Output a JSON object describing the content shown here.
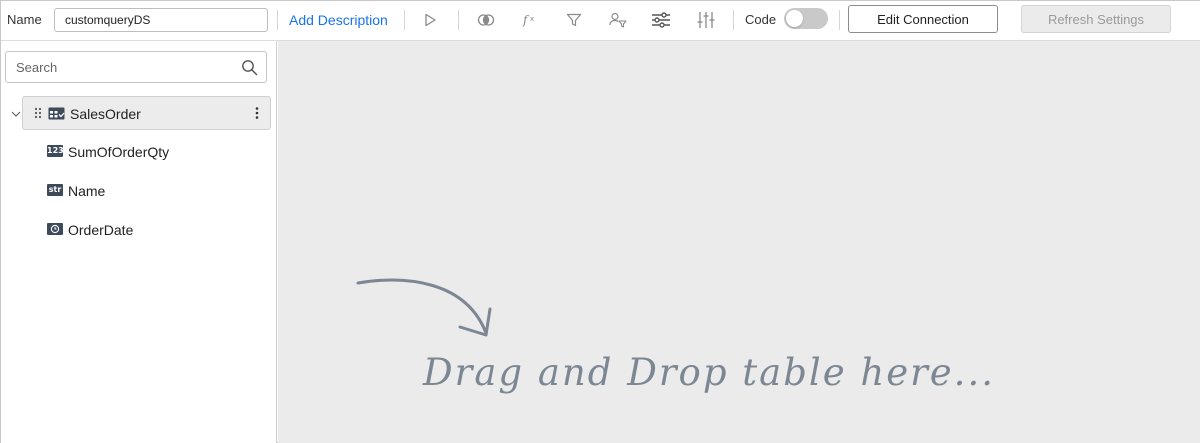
{
  "toolbar": {
    "name_label": "Name",
    "name_value": "customqueryDS",
    "add_description": "Add Description",
    "code_label": "Code",
    "code_enabled": false,
    "edit_connection": "Edit Connection",
    "refresh_settings": "Refresh Settings",
    "icons": [
      "play-icon",
      "join-icon",
      "function-icon",
      "filter-icon",
      "user-filter-icon",
      "settings-sliders-icon",
      "vertical-sliders-icon"
    ]
  },
  "sidebar": {
    "search_placeholder": "Search",
    "table": {
      "label": "SalesOrder",
      "expanded": true
    },
    "fields": [
      {
        "label": "SumOfOrderQty",
        "type_icon": "123"
      },
      {
        "label": "Name",
        "type_icon": "str"
      },
      {
        "label": "OrderDate",
        "type_icon": "date-icon"
      }
    ]
  },
  "canvas": {
    "drop_text": "Drag and Drop table here..."
  },
  "colors": {
    "accent": "#1a73e8",
    "canvas_bg": "#ebebeb",
    "hint_text": "#7d8794",
    "field_icon_bg": "#3c4a5c"
  }
}
